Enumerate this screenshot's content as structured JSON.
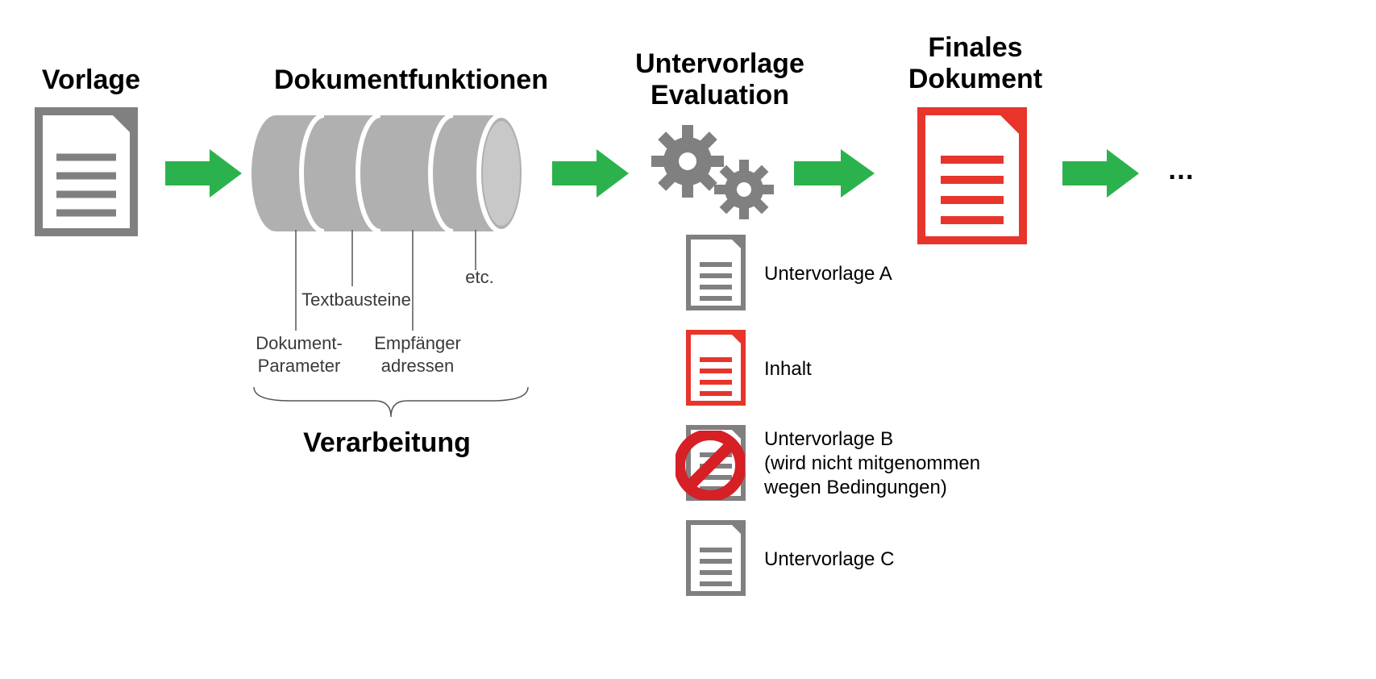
{
  "headings": {
    "vorlage": "Vorlage",
    "dokumentfunktionen": "Dokumentfunktionen",
    "untervorlage_eval_1": "Untervorlage",
    "untervorlage_eval_2": "Evaluation",
    "finales_1": "Finales",
    "finales_2": "Dokument",
    "verarbeitung": "Verarbeitung"
  },
  "labels": {
    "dokument_parameter_1": "Dokument-",
    "dokument_parameter_2": "Parameter",
    "textbausteine": "Textbausteine",
    "empfaenger_1": "Empfänger",
    "empfaenger_2": "adressen",
    "etc": "etc."
  },
  "subs": {
    "a": "Untervorlage A",
    "inhalt": "Inhalt",
    "b_1": "Untervorlage B",
    "b_2": "(wird nicht mitgenommen",
    "b_3": "wegen Bedingungen)",
    "c": "Untervorlage C"
  },
  "ellipsis": "…",
  "colors": {
    "gray": "#808080",
    "darkgray": "#707070",
    "green": "#2bb24c",
    "red": "#e7352c",
    "lightgray": "#b0b0b0"
  }
}
